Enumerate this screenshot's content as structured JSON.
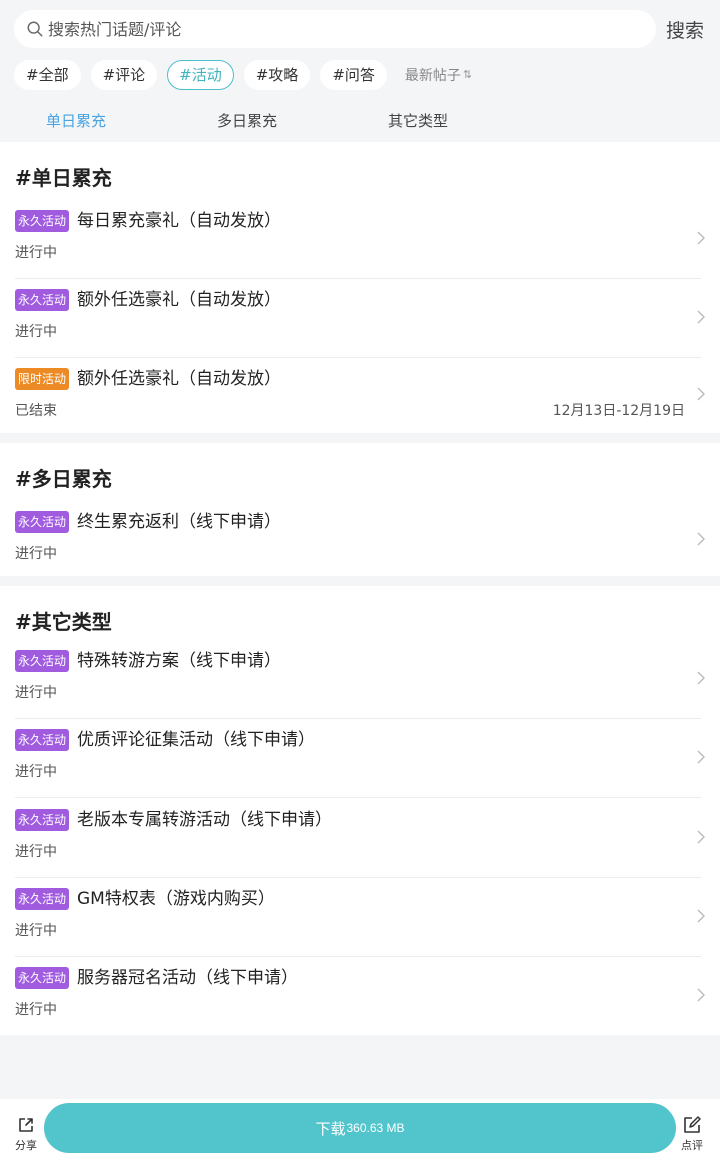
{
  "search": {
    "placeholder": "搜索热门话题/评论",
    "button_label": "搜索"
  },
  "filter_tags": [
    {
      "label": "#全部",
      "active": false
    },
    {
      "label": "#评论",
      "active": false
    },
    {
      "label": "#活动",
      "active": true
    },
    {
      "label": "#攻略",
      "active": false
    },
    {
      "label": "#问答",
      "active": false
    }
  ],
  "sort": {
    "label": "最新帖子",
    "icon": "sort-arrows-icon"
  },
  "tabs": [
    {
      "label": "单日累充",
      "active": true
    },
    {
      "label": "多日累充",
      "active": false
    },
    {
      "label": "其它类型",
      "active": false
    }
  ],
  "badge_colors": {
    "permanent": "#a05bdf",
    "limited": "#ec8b26"
  },
  "accent_color": "#52c4cb",
  "sections": [
    {
      "title": "#单日累充",
      "items": [
        {
          "badge": "永久活动",
          "badge_type": "permanent",
          "title": "每日累充豪礼（自动发放）",
          "status": "进行中",
          "date": ""
        },
        {
          "badge": "永久活动",
          "badge_type": "permanent",
          "title": "额外任选豪礼（自动发放）",
          "status": "进行中",
          "date": ""
        },
        {
          "badge": "限时活动",
          "badge_type": "limited",
          "title": "额外任选豪礼（自动发放）",
          "status": "已结束",
          "date": "12月13日-12月19日"
        }
      ]
    },
    {
      "title": "#多日累充",
      "items": [
        {
          "badge": "永久活动",
          "badge_type": "permanent",
          "title": "终生累充返利（线下申请）",
          "status": "进行中",
          "date": ""
        }
      ]
    },
    {
      "title": "#其它类型",
      "items": [
        {
          "badge": "永久活动",
          "badge_type": "permanent",
          "title": "特殊转游方案（线下申请）",
          "status": "进行中",
          "date": ""
        },
        {
          "badge": "永久活动",
          "badge_type": "permanent",
          "title": "优质评论征集活动（线下申请）",
          "status": "进行中",
          "date": ""
        },
        {
          "badge": "永久活动",
          "badge_type": "permanent",
          "title": "老版本专属转游活动（线下申请）",
          "status": "进行中",
          "date": ""
        },
        {
          "badge": "永久活动",
          "badge_type": "permanent",
          "title": "GM特权表（游戏内购买）",
          "status": "进行中",
          "date": ""
        },
        {
          "badge": "永久活动",
          "badge_type": "permanent",
          "title": "服务器冠名活动（线下申请）",
          "status": "进行中",
          "date": ""
        }
      ]
    }
  ],
  "bottom_bar": {
    "share_label": "分享",
    "download_label": "下载",
    "download_size": "360.63 MB",
    "review_label": "点评"
  }
}
